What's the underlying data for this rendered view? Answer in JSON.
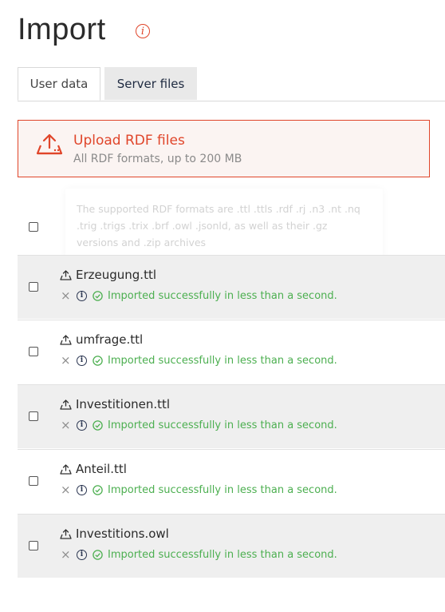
{
  "page": {
    "title": "Import",
    "title_icon": "info-icon"
  },
  "tabs": [
    {
      "label": "User data",
      "active": true
    },
    {
      "label": "Server files",
      "active": false
    }
  ],
  "upload": {
    "title": "Upload RDF files",
    "subtitle": "All RDF formats, up to 200 MB",
    "icon": "upload-icon",
    "accent_color": "#e0452a"
  },
  "tooltip": {
    "text": "The supported RDF formats are .ttl .ttls .rdf .rj .n3 .nt .nq .trig .trigs .trix .brf .owl .jsonld, as well as their .gz versions and .zip archives"
  },
  "files": [
    {
      "name": "Erzeugung.ttl",
      "status": "Imported successfully in less than a second."
    },
    {
      "name": "umfrage.ttl",
      "status": "Imported successfully in less than a second."
    },
    {
      "name": "Investitionen.ttl",
      "status": "Imported successfully in less than a second."
    },
    {
      "name": "Anteil.ttl",
      "status": "Imported successfully in less than a second."
    },
    {
      "name": "Investitions.owl",
      "status": "Imported successfully in less than a second."
    }
  ],
  "colors": {
    "success": "#4caf50",
    "accent": "#e0452a"
  }
}
